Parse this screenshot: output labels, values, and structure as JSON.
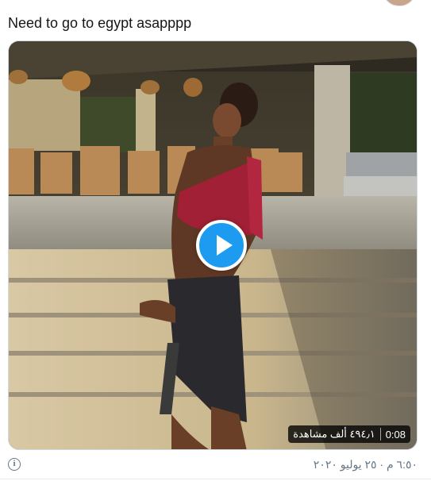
{
  "tweet": {
    "text": "Need to go to egypt asapppp"
  },
  "media": {
    "type": "video",
    "duration": "0:08",
    "views": "٤٩٤٫١ ألف مشاهدة",
    "play_icon": "play-icon"
  },
  "footer": {
    "info_icon": "info-icon",
    "info_glyph": "i",
    "timestamp": "٦:٥٠ م · ٢٥ يوليو ٢٠٢٠"
  },
  "colors": {
    "accent": "#1d9bf0",
    "muted_text": "#657786"
  }
}
